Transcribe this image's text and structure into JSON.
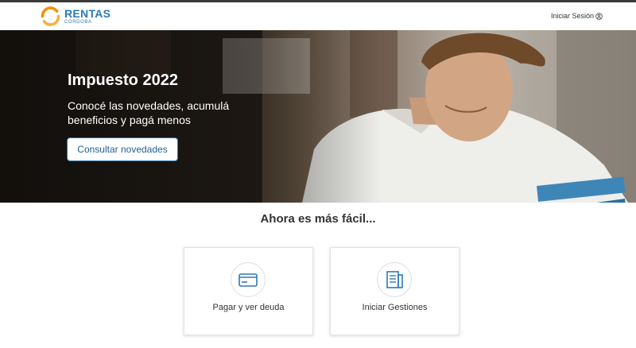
{
  "header": {
    "logo_name": "RENTAS",
    "logo_sub": "CÓRDOBA",
    "login_label": "Iniciar Sesión"
  },
  "hero": {
    "title": "Impuesto 2022",
    "subtitle": "Conocé las novedades, acumulá beneficios y pagá menos",
    "button_label": "Consultar novedades"
  },
  "section": {
    "title": "Ahora es más fácil..."
  },
  "cards": [
    {
      "label": "Pagar y ver deuda",
      "icon": "credit-card-icon"
    },
    {
      "label": "Iniciar Gestiones",
      "icon": "document-icon"
    }
  ],
  "colors": {
    "brand_blue": "#2b7ab8",
    "logo_orange": "#f39200"
  }
}
